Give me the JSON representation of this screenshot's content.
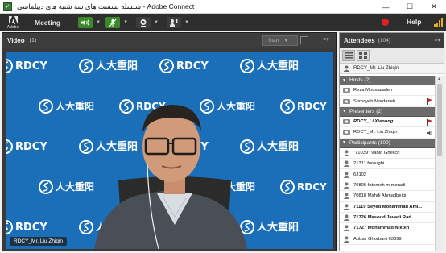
{
  "window": {
    "title": "سلسله نشست های سه شنبه های دیپلماسی - Adobe Connect",
    "controls": [
      "—",
      "☐",
      "✕"
    ]
  },
  "menubar": {
    "logo_text": "Adobe",
    "meeting_label": "Meeting",
    "help_label": "Help"
  },
  "video_pod": {
    "title": "Video",
    "count": "(1)",
    "start_label": "Start",
    "caption": "RDCY_Mr. Liu Zhiqin",
    "backdrop_text_latin": "RDCY",
    "backdrop_text_cjk": "人大重阳"
  },
  "attendees_pod": {
    "title": "Attendees",
    "count": "(104)",
    "current_user": "RDCY_Mr. Liu Zhiqin",
    "sections": [
      {
        "label": "Hosts (2)",
        "rows": [
          {
            "name": "Reza Mousazadeh",
            "bold": false,
            "badge": ""
          },
          {
            "name": "Somayeh Mardaneh",
            "bold": false,
            "badge": "flag-icon"
          }
        ]
      },
      {
        "label": "Presenters (2)",
        "rows": [
          {
            "name": "RDCY_Li Xiapong",
            "bold": true,
            "badge": "flag-icon"
          },
          {
            "name": "RDCY_Mr. Liu Zhiqin",
            "bold": false,
            "badge": "speaker-icon"
          }
        ]
      },
      {
        "label": "Participants (100)",
        "rows": [
          {
            "name": "\"71039\" Vahid Ghelich",
            "bold": false,
            "badge": ""
          },
          {
            "name": "21311 foroughi",
            "bold": false,
            "badge": ""
          },
          {
            "name": "63102",
            "bold": false,
            "badge": ""
          },
          {
            "name": "70805 fatemeh m.moradi",
            "bold": false,
            "badge": ""
          },
          {
            "name": "70818 Mahdi Ahmadbeigi",
            "bold": false,
            "badge": ""
          },
          {
            "name": "71119 Seyed Mohammad Ami...",
            "bold": true,
            "badge": ""
          },
          {
            "name": "71726 Masoud Javadi Rad",
            "bold": true,
            "badge": ""
          },
          {
            "name": "71727 Mohammad Nikbin",
            "bold": true,
            "badge": ""
          },
          {
            "name": "Abbas Ghorbani 63399",
            "bold": false,
            "badge": ""
          }
        ]
      }
    ]
  },
  "colors": {
    "backdrop_blue": "#1a6fb8",
    "record_red": "#e02020",
    "mic_green": "#3a8a2a"
  }
}
